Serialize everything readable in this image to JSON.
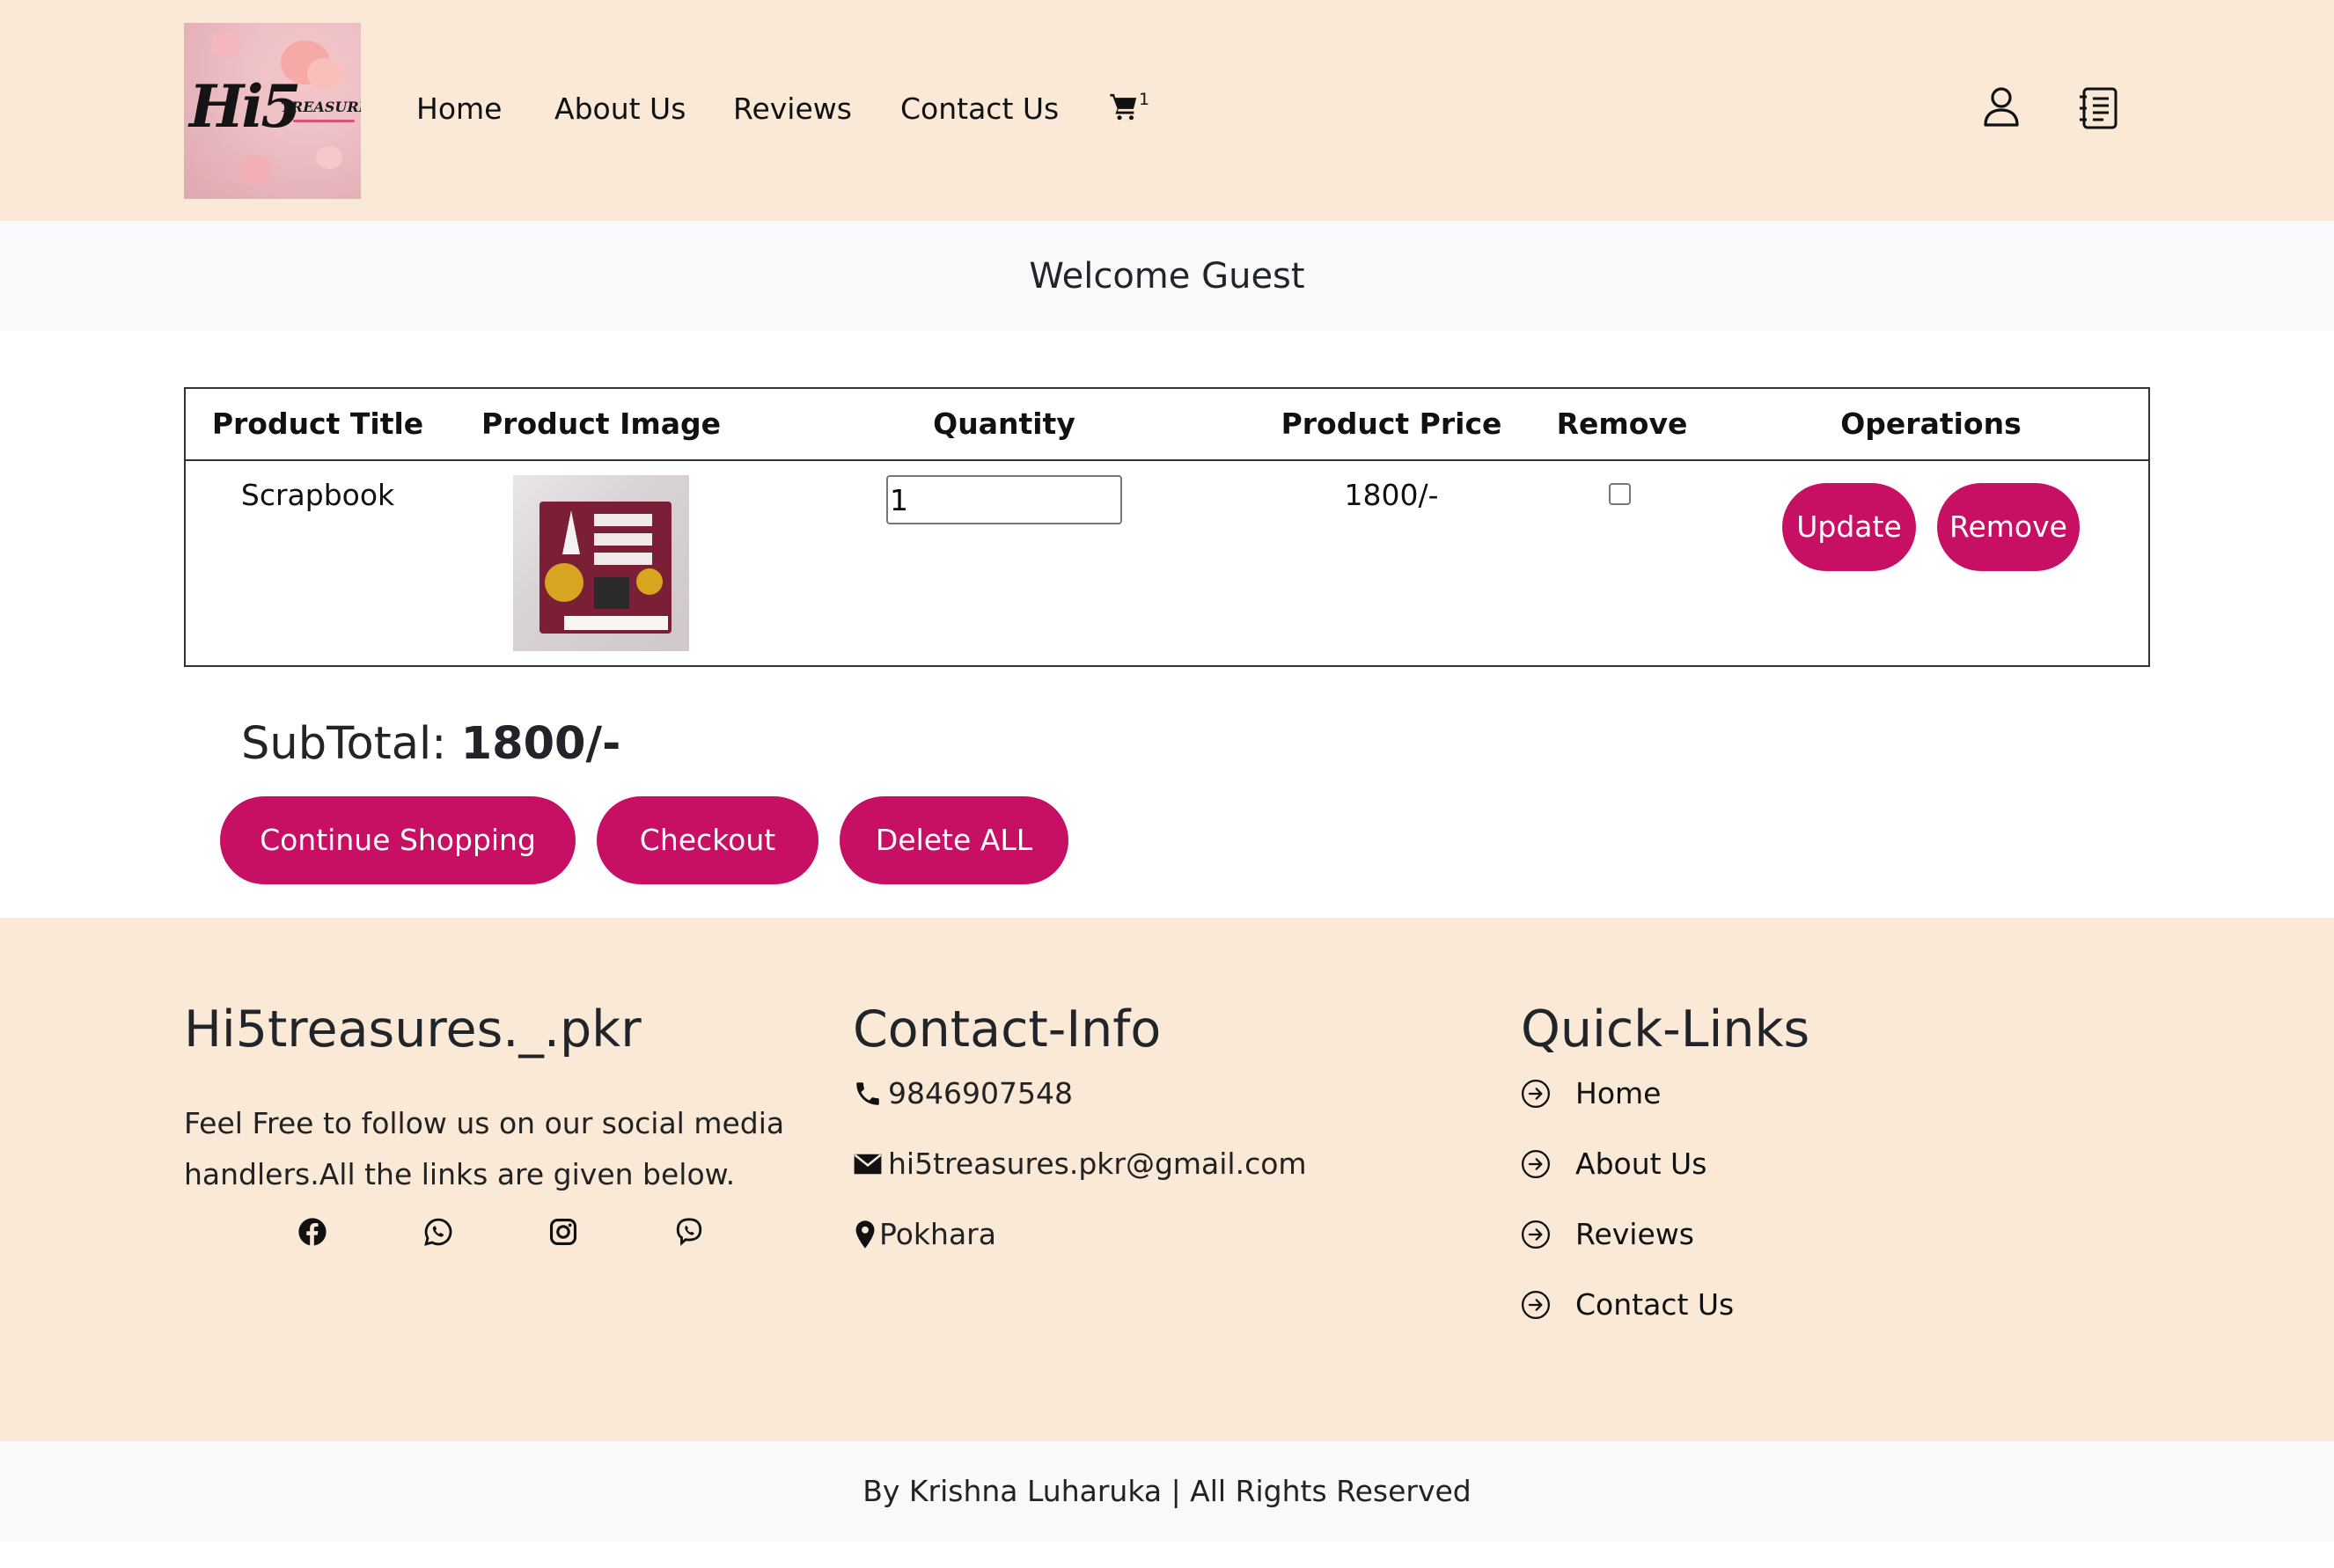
{
  "brand": {
    "logo_main": "Hi5",
    "logo_sub": "TREASURES"
  },
  "nav": {
    "items": [
      {
        "label": "Home"
      },
      {
        "label": "About Us"
      },
      {
        "label": "Reviews"
      },
      {
        "label": "Contact Us"
      }
    ],
    "cart_count": "1",
    "icons": [
      "cart-icon",
      "user-icon",
      "notebook-icon"
    ]
  },
  "welcome": {
    "text": "Welcome Guest"
  },
  "cart": {
    "headers": {
      "title": "Product Title",
      "image": "Product Image",
      "quantity": "Quantity",
      "price": "Product Price",
      "remove": "Remove",
      "operations": "Operations"
    },
    "rows": [
      {
        "title": "Scrapbook",
        "quantity": "1",
        "price": "1800/-",
        "remove_checked": false,
        "update_label": "Update",
        "remove_label": "Remove"
      }
    ]
  },
  "summary": {
    "subtotal_label": "SubTotal:",
    "subtotal_value": "1800/-",
    "buttons": {
      "continue": "Continue Shopping",
      "checkout": "Checkout",
      "delete_all": "Delete ALL"
    }
  },
  "footer": {
    "about": {
      "heading": "Hi5treasures._.pkr",
      "text": "Feel Free to follow us on our social media handlers.All the links are given below.",
      "social_icons": [
        "facebook-icon",
        "whatsapp-icon",
        "instagram-icon",
        "viber-icon"
      ]
    },
    "contact": {
      "heading": "Contact-Info",
      "phone": "9846907548",
      "email": "hi5treasures.pkr@gmail.com",
      "location": "Pokhara"
    },
    "quick_links": {
      "heading": "Quick-Links",
      "items": [
        {
          "label": "Home"
        },
        {
          "label": "About Us"
        },
        {
          "label": "Reviews"
        },
        {
          "label": "Contact Us"
        }
      ]
    },
    "copyright": "By Krishna Luharuka | All Rights Reserved"
  },
  "colors": {
    "header_bg": "#f9e9d6",
    "welcome_bg": "#f8f9fa",
    "accent": "#c70f64"
  }
}
